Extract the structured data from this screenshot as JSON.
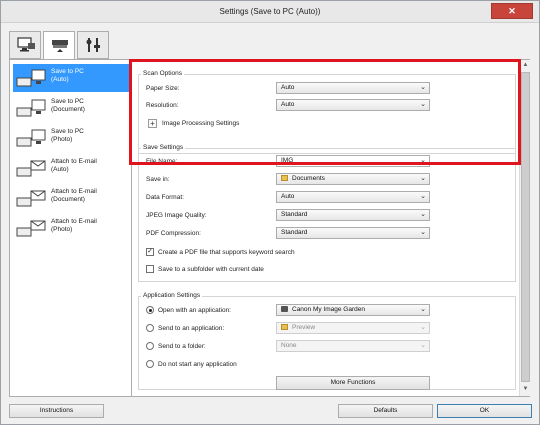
{
  "window": {
    "title": "Settings (Save to PC (Auto))"
  },
  "tabs": [
    {
      "name": "scan-from-computer-icon"
    },
    {
      "name": "scan-from-operation-panel-icon"
    },
    {
      "name": "general-settings-icon"
    }
  ],
  "sidebar": {
    "items": [
      {
        "label": "Save to PC\n(Auto)",
        "icon": "scanner-monitor-icon"
      },
      {
        "label": "Save to PC\n(Document)",
        "icon": "scanner-monitor-icon"
      },
      {
        "label": "Save to PC\n(Photo)",
        "icon": "scanner-monitor-icon"
      },
      {
        "label": "Attach to E-mail\n(Auto)",
        "icon": "scanner-mail-icon"
      },
      {
        "label": "Attach to E-mail\n(Document)",
        "icon": "scanner-mail-icon"
      },
      {
        "label": "Attach to E-mail\n(Photo)",
        "icon": "scanner-mail-icon"
      }
    ]
  },
  "scan_options": {
    "title": "Scan Options",
    "paper_size_label": "Paper Size:",
    "paper_size_value": "Auto",
    "resolution_label": "Resolution:",
    "resolution_value": "Auto",
    "image_processing_label": "Image Processing Settings"
  },
  "save_settings": {
    "title": "Save Settings",
    "file_name_label": "File Name:",
    "file_name_value": "IMG",
    "save_in_label": "Save in:",
    "save_in_value": "Documents",
    "data_format_label": "Data Format:",
    "data_format_value": "Auto",
    "jpeg_quality_label": "JPEG Image Quality:",
    "jpeg_quality_value": "Standard",
    "pdf_compression_label": "PDF Compression:",
    "pdf_compression_value": "Standard",
    "keyword_pdf_label": "Create a PDF file that supports keyword search",
    "keyword_pdf_checked": true,
    "subfolder_label": "Save to a subfolder with current date",
    "subfolder_checked": false
  },
  "application_settings": {
    "title": "Application Settings",
    "open_app_label": "Open with an application:",
    "open_app_value": "Canon My Image Garden",
    "send_app_label": "Send to an application:",
    "send_app_value": "Preview",
    "send_folder_label": "Send to a folder:",
    "send_folder_value": "None",
    "no_app_label": "Do not start any application",
    "more_functions_label": "More Functions"
  },
  "footer": {
    "instructions_label": "Instructions",
    "defaults_label": "Defaults",
    "ok_label": "OK"
  },
  "colors": {
    "accent": "#3399ff",
    "highlight": "#e0141e"
  }
}
